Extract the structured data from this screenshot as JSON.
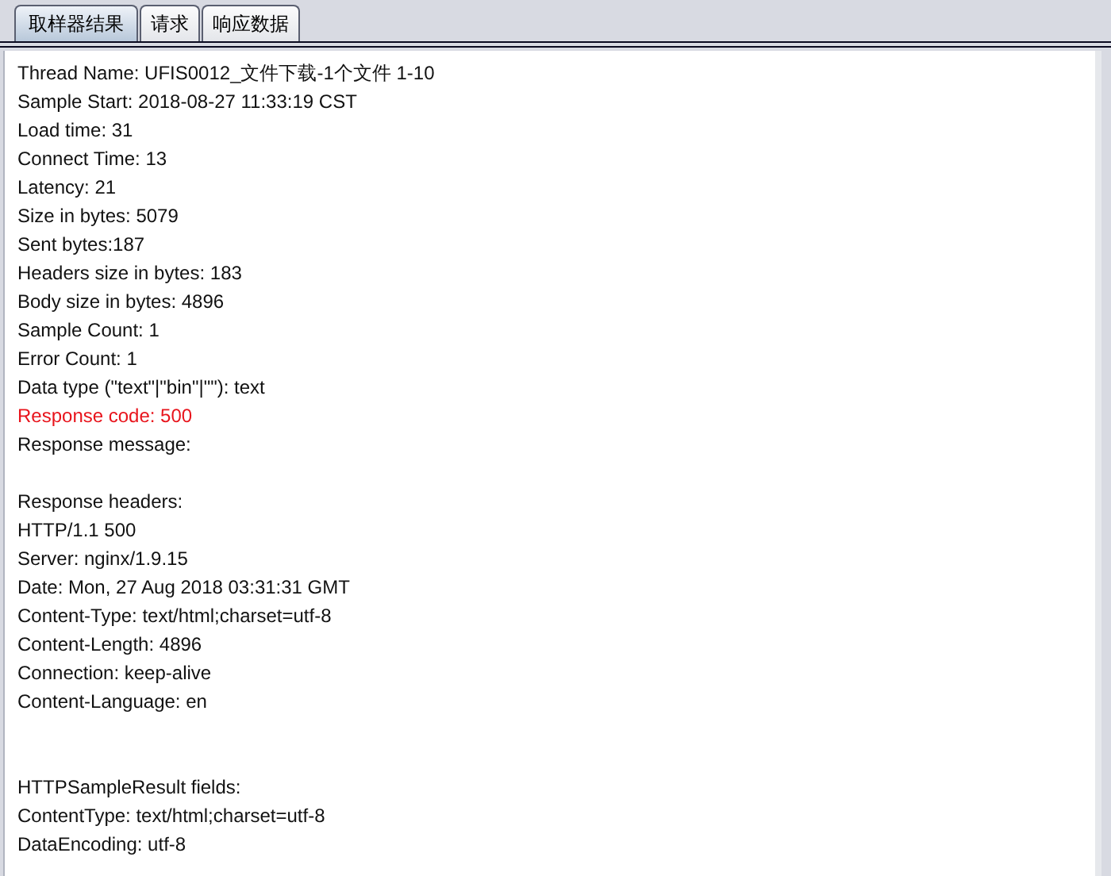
{
  "tabs": [
    {
      "label": "取样器结果",
      "selected": true
    },
    {
      "label": "请求",
      "selected": false
    },
    {
      "label": "响应数据",
      "selected": false
    }
  ],
  "lines": [
    {
      "kind": "text",
      "text": "Thread Name: UFIS0012_文件下载-1个文件 1-10"
    },
    {
      "kind": "text",
      "text": "Sample Start: 2018-08-27 11:33:19 CST"
    },
    {
      "kind": "text",
      "text": "Load time: 31"
    },
    {
      "kind": "text",
      "text": "Connect Time: 13"
    },
    {
      "kind": "text",
      "text": "Latency: 21"
    },
    {
      "kind": "text",
      "text": "Size in bytes: 5079"
    },
    {
      "kind": "text",
      "text": "Sent bytes:187"
    },
    {
      "kind": "text",
      "text": "Headers size in bytes: 183"
    },
    {
      "kind": "text",
      "text": "Body size in bytes: 4896"
    },
    {
      "kind": "text",
      "text": "Sample Count: 1"
    },
    {
      "kind": "text",
      "text": "Error Count: 1"
    },
    {
      "kind": "text",
      "text": "Data type (\"text\"|\"bin\"|\"\"): text"
    },
    {
      "kind": "error",
      "text": "Response code: 500"
    },
    {
      "kind": "text",
      "text": "Response message:"
    },
    {
      "kind": "blank"
    },
    {
      "kind": "text",
      "text": "Response headers:"
    },
    {
      "kind": "text",
      "text": "HTTP/1.1 500"
    },
    {
      "kind": "text",
      "text": "Server: nginx/1.9.15"
    },
    {
      "kind": "text",
      "text": "Date: Mon, 27 Aug 2018 03:31:31 GMT"
    },
    {
      "kind": "text",
      "text": "Content-Type: text/html;charset=utf-8"
    },
    {
      "kind": "text",
      "text": "Content-Length: 4896"
    },
    {
      "kind": "text",
      "text": "Connection: keep-alive"
    },
    {
      "kind": "text",
      "text": "Content-Language: en"
    },
    {
      "kind": "blank"
    },
    {
      "kind": "blank"
    },
    {
      "kind": "text",
      "text": "HTTPSampleResult fields:"
    },
    {
      "kind": "text",
      "text": "ContentType: text/html;charset=utf-8"
    },
    {
      "kind": "text",
      "text": "DataEncoding: utf-8"
    }
  ]
}
